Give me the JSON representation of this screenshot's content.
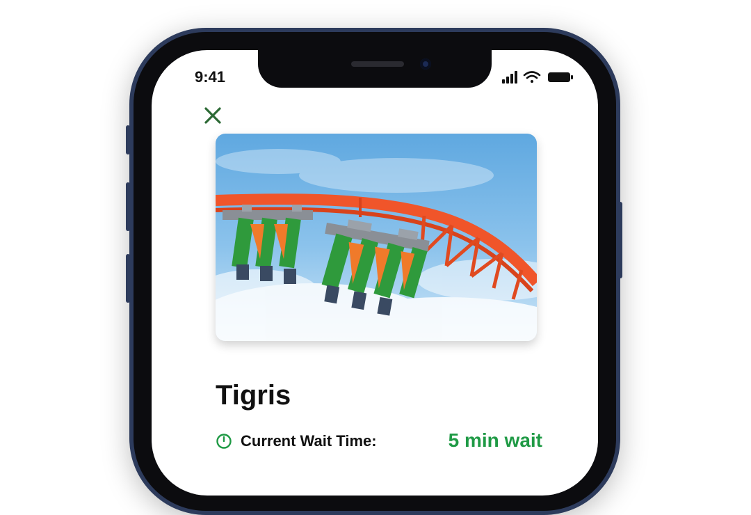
{
  "status_bar": {
    "time": "9:41",
    "icons": [
      "cellular-signal-icon",
      "wifi-icon",
      "battery-icon"
    ]
  },
  "close_icon": "close-icon",
  "ride": {
    "image_icon": "roller-coaster-photo",
    "name": "Tigris",
    "wait_label": "Current Wait Time:",
    "wait_value": "5 min wait"
  },
  "colors": {
    "accent_green": "#1f9a45",
    "close_green": "#2c6a35",
    "track_orange": "#f0552a",
    "phone_frame": "#2d3b5c"
  }
}
